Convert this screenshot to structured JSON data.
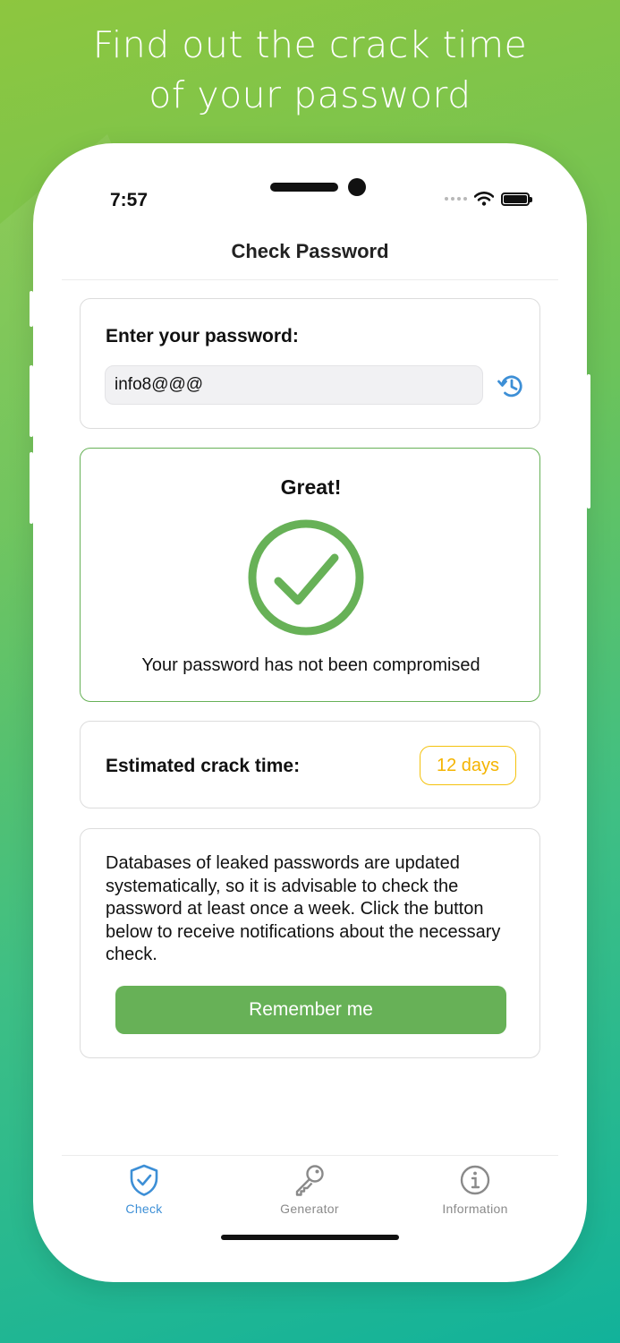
{
  "promo": {
    "headline_line1": "Find out the crack time",
    "headline_line2": "of your password"
  },
  "status_bar": {
    "time": "7:57"
  },
  "nav": {
    "title": "Check Password"
  },
  "password_card": {
    "label": "Enter your password:",
    "value": "info8@@@",
    "history_icon": "history-icon"
  },
  "result_card": {
    "title": "Great!",
    "icon": "check-circle-icon",
    "message": "Your password has not been compromised",
    "accent_color": "#67b157"
  },
  "crack_card": {
    "label": "Estimated crack time:",
    "value": "12 days",
    "badge_color": "#f4c20d"
  },
  "info_card": {
    "text": "Databases of leaked passwords are updated systematically, so it is advisable to check the password at least once a week. Click the button below to receive notifications about the necessary check.",
    "button_label": "Remember me",
    "button_color": "#67b157"
  },
  "tabbar": {
    "tabs": [
      {
        "label": "Check",
        "icon": "shield-check-icon",
        "active": true
      },
      {
        "label": "Generator",
        "icon": "key-icon",
        "active": false
      },
      {
        "label": "Information",
        "icon": "info-icon",
        "active": false
      }
    ],
    "active_color": "#3d8fd6",
    "inactive_color": "#8a8a8a"
  }
}
